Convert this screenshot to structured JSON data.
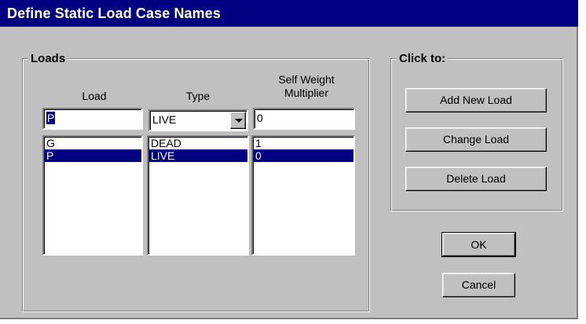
{
  "window": {
    "title": "Define Static Load Case Names"
  },
  "loads_group": {
    "legend": "Loads",
    "columns": {
      "load": "Load",
      "type": "Type",
      "self_weight_line1": "Self Weight",
      "self_weight_line2": "Multiplier"
    },
    "inputs": {
      "load_value": "P",
      "type_value": "LIVE",
      "multiplier_value": "0"
    },
    "rows": [
      {
        "load": "G",
        "type": "DEAD",
        "multiplier": "1",
        "selected": false
      },
      {
        "load": "P",
        "type": "LIVE",
        "multiplier": "0",
        "selected": true
      }
    ]
  },
  "actions_group": {
    "legend": "Click to:",
    "add_label": "Add New Load",
    "change_label": "Change Load",
    "delete_label": "Delete Load"
  },
  "footer": {
    "ok_label": "OK",
    "cancel_label": "Cancel"
  },
  "colors": {
    "title_bar": "#000080",
    "face": "#c0c0c0",
    "selection": "#000080"
  },
  "icons": {
    "combo_arrow": "chevron-down-icon"
  }
}
